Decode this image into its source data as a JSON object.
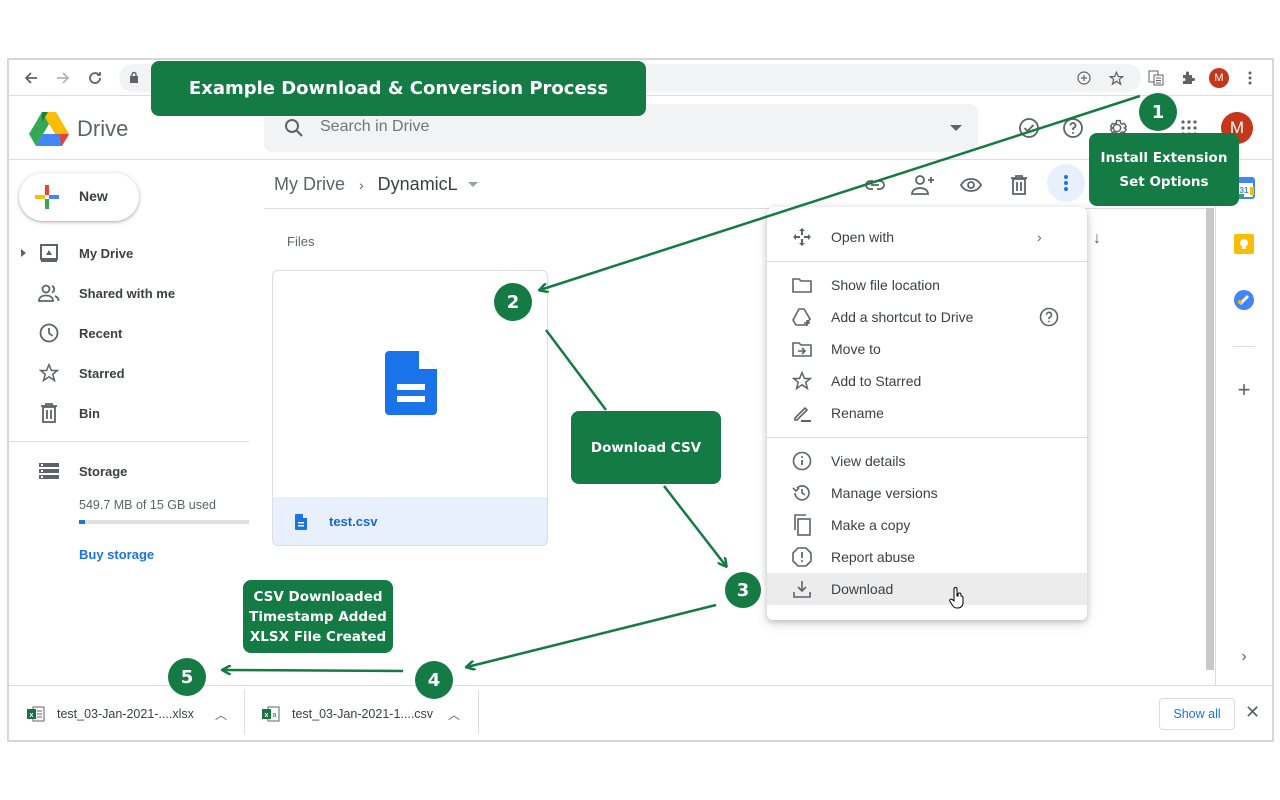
{
  "browser": {
    "back_icon": "arrow-left-icon",
    "forward_icon": "arrow-right-icon",
    "reload_icon": "reload-icon",
    "profile_initial": "M"
  },
  "header": {
    "app_name": "Drive",
    "search_placeholder": "Search in Drive",
    "profile_initial": "M"
  },
  "sidebar": {
    "new_label": "New",
    "items": [
      {
        "label": "My Drive",
        "icon": "my-drive-icon"
      },
      {
        "label": "Shared with me",
        "icon": "shared-icon"
      },
      {
        "label": "Recent",
        "icon": "clock-icon"
      },
      {
        "label": "Starred",
        "icon": "star-icon"
      },
      {
        "label": "Bin",
        "icon": "trash-icon"
      }
    ],
    "storage_label": "Storage",
    "storage_used_text": "549.7 MB of 15 GB used",
    "storage_used_fraction": 0.036,
    "buy_storage": "Buy storage"
  },
  "main": {
    "breadcrumb": [
      "My Drive",
      "DynamicL"
    ],
    "breadcrumb_sep": "›",
    "section_label": "Files",
    "file": {
      "name": "test.csv"
    }
  },
  "menu": {
    "items": [
      {
        "label": "Open with",
        "icon": "open-with-icon"
      },
      {
        "label": "Show file location",
        "icon": "folder-icon"
      },
      {
        "label": "Add a shortcut to Drive",
        "icon": "add-shortcut-icon"
      },
      {
        "label": "Move to",
        "icon": "move-to-icon"
      },
      {
        "label": "Add to Starred",
        "icon": "star-icon"
      },
      {
        "label": "Rename",
        "icon": "pencil-icon"
      },
      {
        "label": "View details",
        "icon": "info-icon"
      },
      {
        "label": "Manage versions",
        "icon": "history-icon"
      },
      {
        "label": "Make a copy",
        "icon": "copy-icon"
      },
      {
        "label": "Report abuse",
        "icon": "report-icon"
      },
      {
        "label": "Download",
        "icon": "download-icon"
      }
    ],
    "open_with_chevron": "›",
    "hovered": "Download"
  },
  "downloads": {
    "items": [
      {
        "name": "test_03-Jan-2021-....xlsx"
      },
      {
        "name": "test_03-Jan-2021-1....csv"
      }
    ],
    "show_all": "Show all",
    "close": "✕"
  },
  "annotations": {
    "title": "Example Download & Conversion Process",
    "step1": "1",
    "step1_text_line1": "Install Extension",
    "step1_text_line2": "Set Options",
    "step2": "2",
    "step2_text": "Download CSV",
    "step3": "3",
    "step4": "4",
    "step4_text_line1": "CSV Downloaded",
    "step4_text_line2": "Timestamp Added",
    "step4_text_line3": "XLSX File Created",
    "step5": "5",
    "color": "#137b43"
  },
  "colors": {
    "accent_blue": "#1a73e8",
    "avatar": "#c5361b",
    "annotation_green": "#137b43"
  }
}
